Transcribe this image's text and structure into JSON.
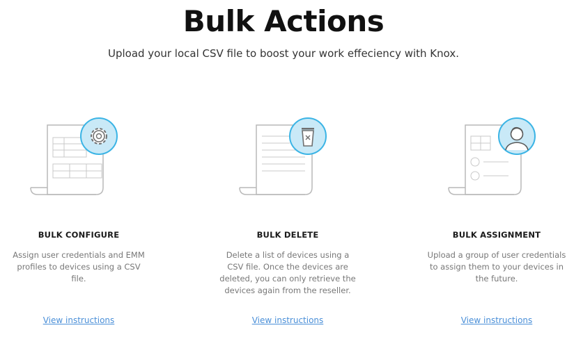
{
  "header": {
    "title": "Bulk Actions",
    "subtitle": "Upload your local CSV file to boost your work effeciency with Knox."
  },
  "cards": [
    {
      "title": "BULK CONFIGURE",
      "description": "Assign user credentials and EMM profiles to devices using a CSV file.",
      "link": "View instructions",
      "icon": "gear-icon"
    },
    {
      "title": "BULK DELETE",
      "description": "Delete a list of devices using a CSV file. Once the devices are deleted, you can only retrieve the devices again from the reseller.",
      "link": "View instructions",
      "icon": "trash-icon"
    },
    {
      "title": "BULK ASSIGNMENT",
      "description": "Upload a group of user credentials to assign them to your devices in the future.",
      "link": "View instructions",
      "icon": "user-icon"
    }
  ],
  "colors": {
    "accent_fill": "#c9e9f7",
    "accent_stroke": "#3bb4e5",
    "link": "#4a8fd8"
  }
}
